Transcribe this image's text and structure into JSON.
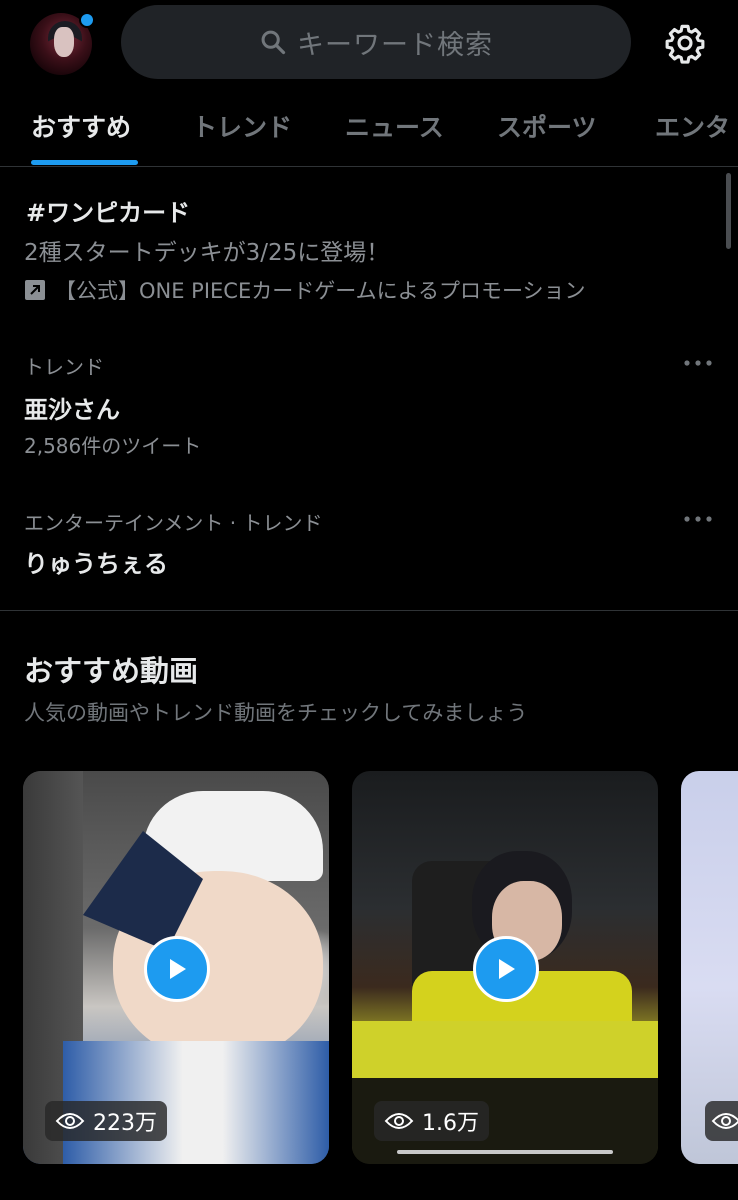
{
  "header": {
    "search_placeholder": "キーワード検索"
  },
  "tabs": [
    {
      "label": "おすすめ",
      "active": true
    },
    {
      "label": "トレンド",
      "active": false
    },
    {
      "label": "ニュース",
      "active": false
    },
    {
      "label": "スポーツ",
      "active": false
    },
    {
      "label": "エンタ",
      "active": false
    }
  ],
  "trends": {
    "promoted": {
      "title": "#ワンピカード",
      "description": "2種スタートデッキが3/25に登場！",
      "promoter": "【公式】ONE PIECEカードゲームによるプロモーション"
    },
    "items": [
      {
        "category": "トレンド",
        "title": "亜沙さん",
        "count": "2,586件のツイート"
      },
      {
        "category": "エンターテインメント · トレンド",
        "title": "りゅうちぇる"
      }
    ]
  },
  "videos": {
    "title": "おすすめ動画",
    "subtitle": "人気の動画やトレンド動画をチェックしてみましょう",
    "cards": [
      {
        "views": "223万"
      },
      {
        "views": "1.6万"
      }
    ]
  },
  "colors": {
    "accent": "#1d9bf0",
    "background": "#000000",
    "search_bg": "#202327",
    "muted_text": "#71767b"
  }
}
